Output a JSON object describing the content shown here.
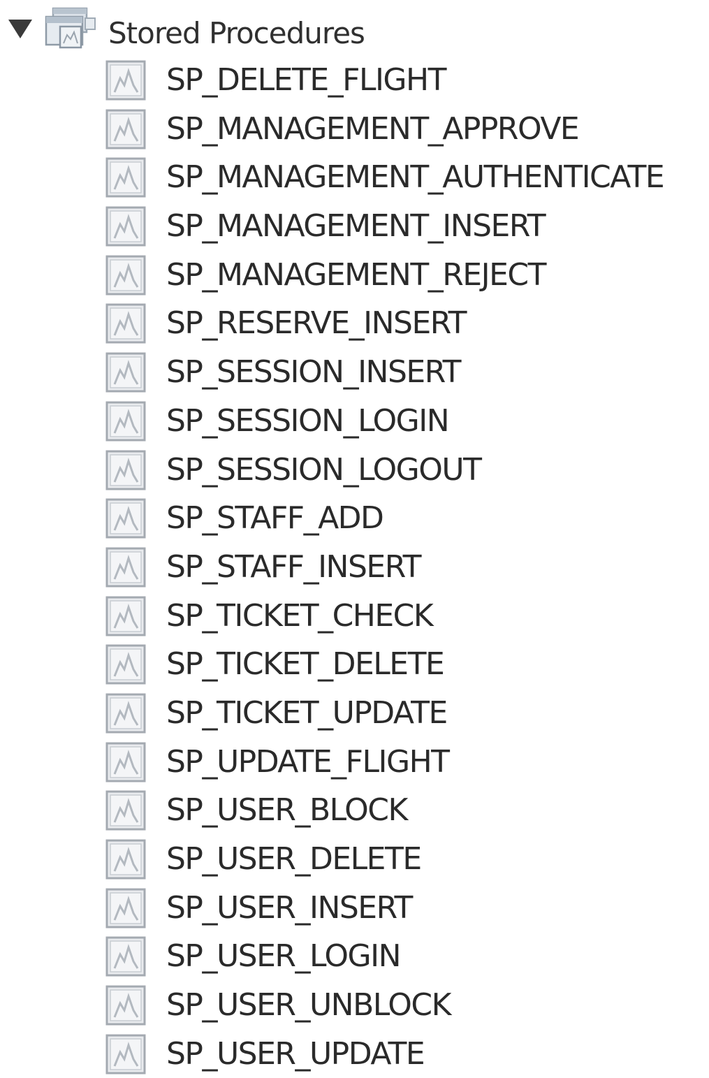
{
  "tree": {
    "folder": {
      "label": "Stored Procedures",
      "expanded": true,
      "toggle_icon": "triangle-down-icon",
      "icon": "stored-procedures-folder-icon"
    },
    "item_icon": "stored-procedure-icon",
    "items": [
      {
        "label": "SP_DELETE_FLIGHT"
      },
      {
        "label": "SP_MANAGEMENT_APPROVE"
      },
      {
        "label": "SP_MANAGEMENT_AUTHENTICATE"
      },
      {
        "label": "SP_MANAGEMENT_INSERT"
      },
      {
        "label": "SP_MANAGEMENT_REJECT"
      },
      {
        "label": "SP_RESERVE_INSERT"
      },
      {
        "label": "SP_SESSION_INSERT"
      },
      {
        "label": "SP_SESSION_LOGIN"
      },
      {
        "label": "SP_SESSION_LOGOUT"
      },
      {
        "label": "SP_STAFF_ADD"
      },
      {
        "label": "SP_STAFF_INSERT"
      },
      {
        "label": "SP_TICKET_CHECK"
      },
      {
        "label": "SP_TICKET_DELETE"
      },
      {
        "label": "SP_TICKET_UPDATE"
      },
      {
        "label": "SP_UPDATE_FLIGHT"
      },
      {
        "label": "SP_USER_BLOCK"
      },
      {
        "label": "SP_USER_DELETE"
      },
      {
        "label": "SP_USER_INSERT"
      },
      {
        "label": "SP_USER_LOGIN"
      },
      {
        "label": "SP_USER_UNBLOCK"
      },
      {
        "label": "SP_USER_UPDATE"
      }
    ]
  }
}
